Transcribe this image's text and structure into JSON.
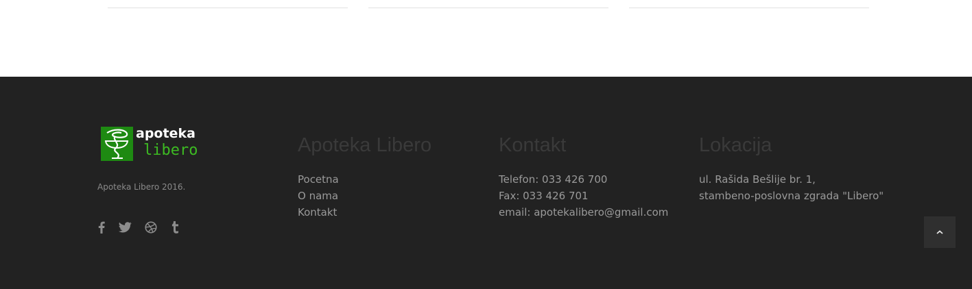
{
  "logo": {
    "line1": "apoteka",
    "line2": "libero",
    "brand_color": "#1e8a12",
    "accent_color": "#3dbb22"
  },
  "footer": {
    "copyright": "Apoteka Libero 2016.",
    "social": [
      "facebook-icon",
      "twitter-icon",
      "dribbble-icon",
      "tumblr-icon"
    ],
    "columns": [
      {
        "title": "Apoteka Libero",
        "links": [
          "Pocetna",
          "O nama",
          "Kontakt"
        ]
      },
      {
        "title": "Kontakt",
        "lines": [
          "Telefon: 033 426 700",
          "Fax: 033 426 701",
          "email: apotekalibero@gmail.com"
        ]
      },
      {
        "title": "Lokacija",
        "lines": [
          "ul. Rašida Bešlije br. 1,",
          "stambeno-poslovna zgrada \"Libero\""
        ]
      }
    ],
    "background_color": "#222222"
  },
  "scroll_top": {
    "icon": "chevron-up-icon"
  }
}
